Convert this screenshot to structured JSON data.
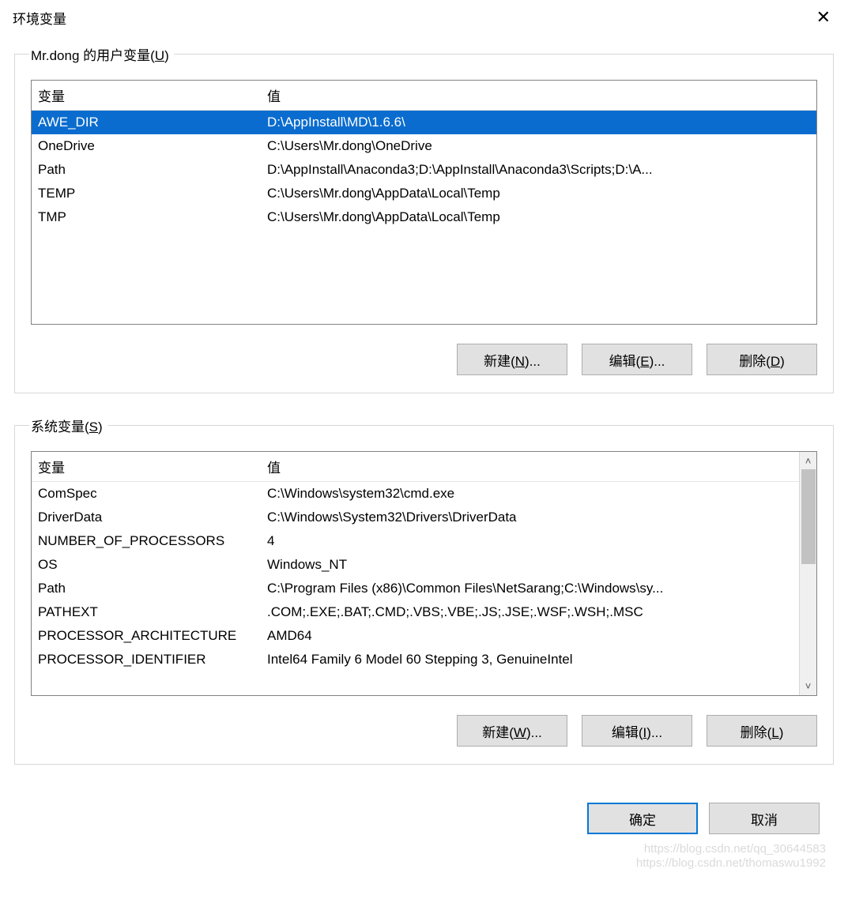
{
  "window": {
    "title": "环境变量",
    "close_label": "✕"
  },
  "user_section": {
    "legend_prefix": "Mr.dong 的用户变量(",
    "legend_hotkey": "U",
    "legend_suffix": ")",
    "col_variable": "变量",
    "col_value": "值",
    "rows": [
      {
        "name": "AWE_DIR",
        "value": "D:\\AppInstall\\MD\\1.6.6\\",
        "selected": true
      },
      {
        "name": "OneDrive",
        "value": "C:\\Users\\Mr.dong\\OneDrive",
        "selected": false
      },
      {
        "name": "Path",
        "value": "D:\\AppInstall\\Anaconda3;D:\\AppInstall\\Anaconda3\\Scripts;D:\\A...",
        "selected": false
      },
      {
        "name": "TEMP",
        "value": "C:\\Users\\Mr.dong\\AppData\\Local\\Temp",
        "selected": false
      },
      {
        "name": "TMP",
        "value": "C:\\Users\\Mr.dong\\AppData\\Local\\Temp",
        "selected": false
      }
    ],
    "btn_new": {
      "prefix": "新建(",
      "hotkey": "N",
      "suffix": ")..."
    },
    "btn_edit": {
      "prefix": "编辑(",
      "hotkey": "E",
      "suffix": ")..."
    },
    "btn_del": {
      "prefix": "删除(",
      "hotkey": "D",
      "suffix": ")"
    }
  },
  "system_section": {
    "legend_prefix": "系统变量(",
    "legend_hotkey": "S",
    "legend_suffix": ")",
    "col_variable": "变量",
    "col_value": "值",
    "rows": [
      {
        "name": "ComSpec",
        "value": "C:\\Windows\\system32\\cmd.exe"
      },
      {
        "name": "DriverData",
        "value": "C:\\Windows\\System32\\Drivers\\DriverData"
      },
      {
        "name": "NUMBER_OF_PROCESSORS",
        "value": "4"
      },
      {
        "name": "OS",
        "value": "Windows_NT"
      },
      {
        "name": "Path",
        "value": "C:\\Program Files (x86)\\Common Files\\NetSarang;C:\\Windows\\sy..."
      },
      {
        "name": "PATHEXT",
        "value": ".COM;.EXE;.BAT;.CMD;.VBS;.VBE;.JS;.JSE;.WSF;.WSH;.MSC"
      },
      {
        "name": "PROCESSOR_ARCHITECTURE",
        "value": "AMD64"
      },
      {
        "name": "PROCESSOR_IDENTIFIER",
        "value": "Intel64 Family 6 Model 60 Stepping 3, GenuineIntel"
      }
    ],
    "btn_new": {
      "prefix": "新建(",
      "hotkey": "W",
      "suffix": ")..."
    },
    "btn_edit": {
      "prefix": "编辑(",
      "hotkey": "I",
      "suffix": ")..."
    },
    "btn_del": {
      "prefix": "删除(",
      "hotkey": "L",
      "suffix": ")"
    }
  },
  "dialog_buttons": {
    "ok": "确定",
    "cancel": "取消"
  },
  "watermark": {
    "line1": "https://blog.csdn.net/qq_30644583",
    "line2": "https://blog.csdn.net/thomaswu1992"
  }
}
